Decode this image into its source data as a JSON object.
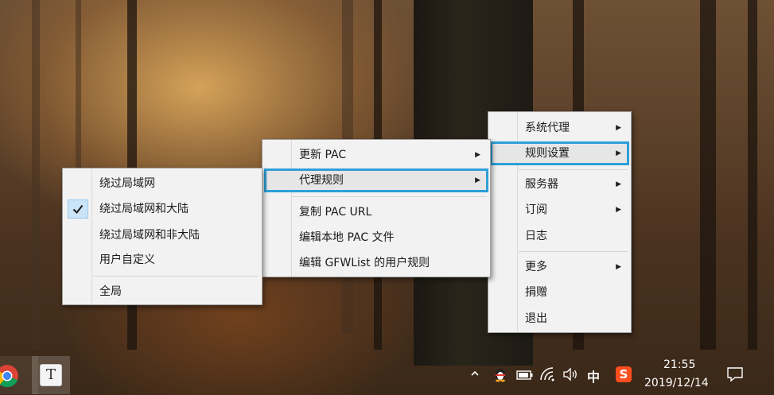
{
  "main_menu": {
    "items": [
      {
        "label": "系统代理",
        "submenu": true
      },
      {
        "label": "规则设置",
        "submenu": true
      },
      {
        "label": "服务器",
        "submenu": true
      },
      {
        "label": "订阅",
        "submenu": true
      },
      {
        "label": "日志",
        "submenu": false
      },
      {
        "label": "更多",
        "submenu": true
      },
      {
        "label": "捐赠",
        "submenu": false
      },
      {
        "label": "退出",
        "submenu": false
      }
    ]
  },
  "rules_menu": {
    "items": [
      {
        "label": "更新 PAC",
        "submenu": true
      },
      {
        "label": "代理规则",
        "submenu": true
      },
      {
        "label": "复制 PAC URL",
        "submenu": false
      },
      {
        "label": "编辑本地 PAC 文件",
        "submenu": false
      },
      {
        "label": "编辑 GFWList 的用户规则",
        "submenu": false
      }
    ]
  },
  "proxy_rules_menu": {
    "items": [
      {
        "label": "绕过局域网",
        "checked": false
      },
      {
        "label": "绕过局域网和大陆",
        "checked": true
      },
      {
        "label": "绕过局域网和非大陆",
        "checked": false
      },
      {
        "label": "用户自定义",
        "checked": false
      },
      {
        "label": "全局",
        "checked": false
      }
    ]
  },
  "taskbar": {
    "input_method": "中",
    "sogou_label": "S",
    "typora_label": "T",
    "time": "21:55",
    "date": "2019/12/14"
  },
  "arrow_glyph": "▶",
  "colors": {
    "highlight_border": "#2e9fd8",
    "menu_bg": "#f2f2f2",
    "check_bg": "#cce4f7"
  }
}
